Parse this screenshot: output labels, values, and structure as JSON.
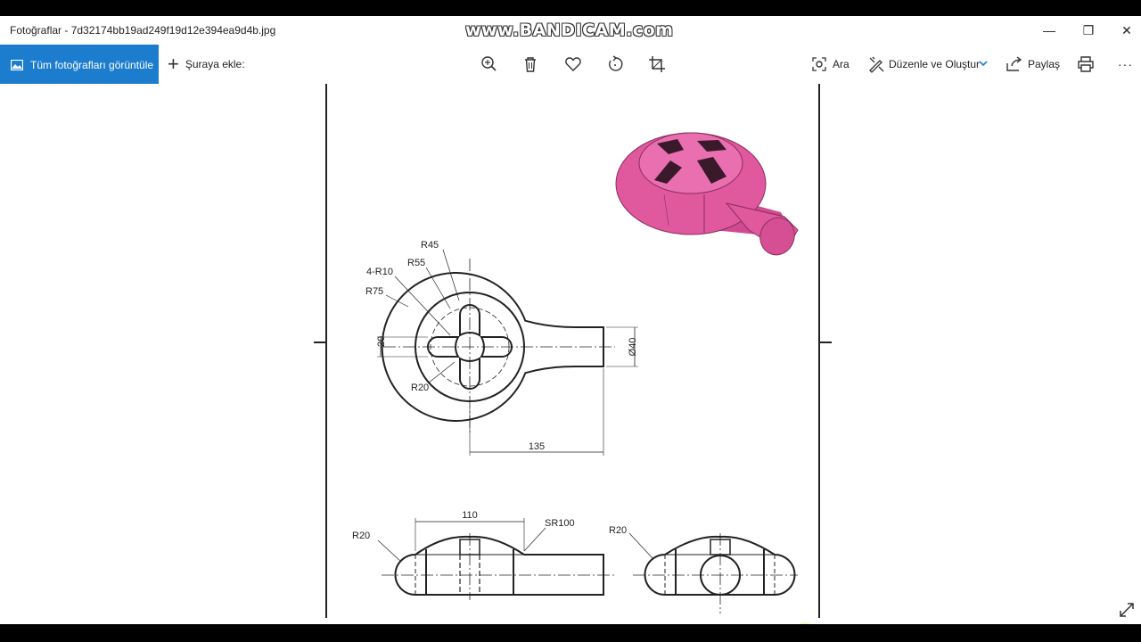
{
  "window": {
    "title": "Fotoğraflar - 7d32174bb19ad249f19d12e394ea9d4b.jpg",
    "watermark": "www.BANDICAM.com",
    "controls": {
      "minimize": "—",
      "restore": "❐",
      "close": "✕"
    }
  },
  "toolbar": {
    "all_photos_label": "Tüm fotoğrafları görüntüle",
    "add_to_label": "Şuraya ekle:",
    "search_label": "Ara",
    "edit_create_label": "Düzenle ve Oluştur",
    "share_label": "Paylaş",
    "more_label": "···",
    "accent_color": "#1c7dcf"
  },
  "drawing": {
    "top_view": {
      "r45": "R45",
      "r55": "R55",
      "r10": "4-R10",
      "r75": "R75",
      "dim20": "20",
      "r20": "R20",
      "d40": "Ø40",
      "dim135": "135"
    },
    "front_view": {
      "dim110": "110",
      "sr100": "SR100",
      "r20": "R20"
    },
    "side_view": {
      "r20": "R20"
    },
    "model_color": "#e0589e"
  }
}
